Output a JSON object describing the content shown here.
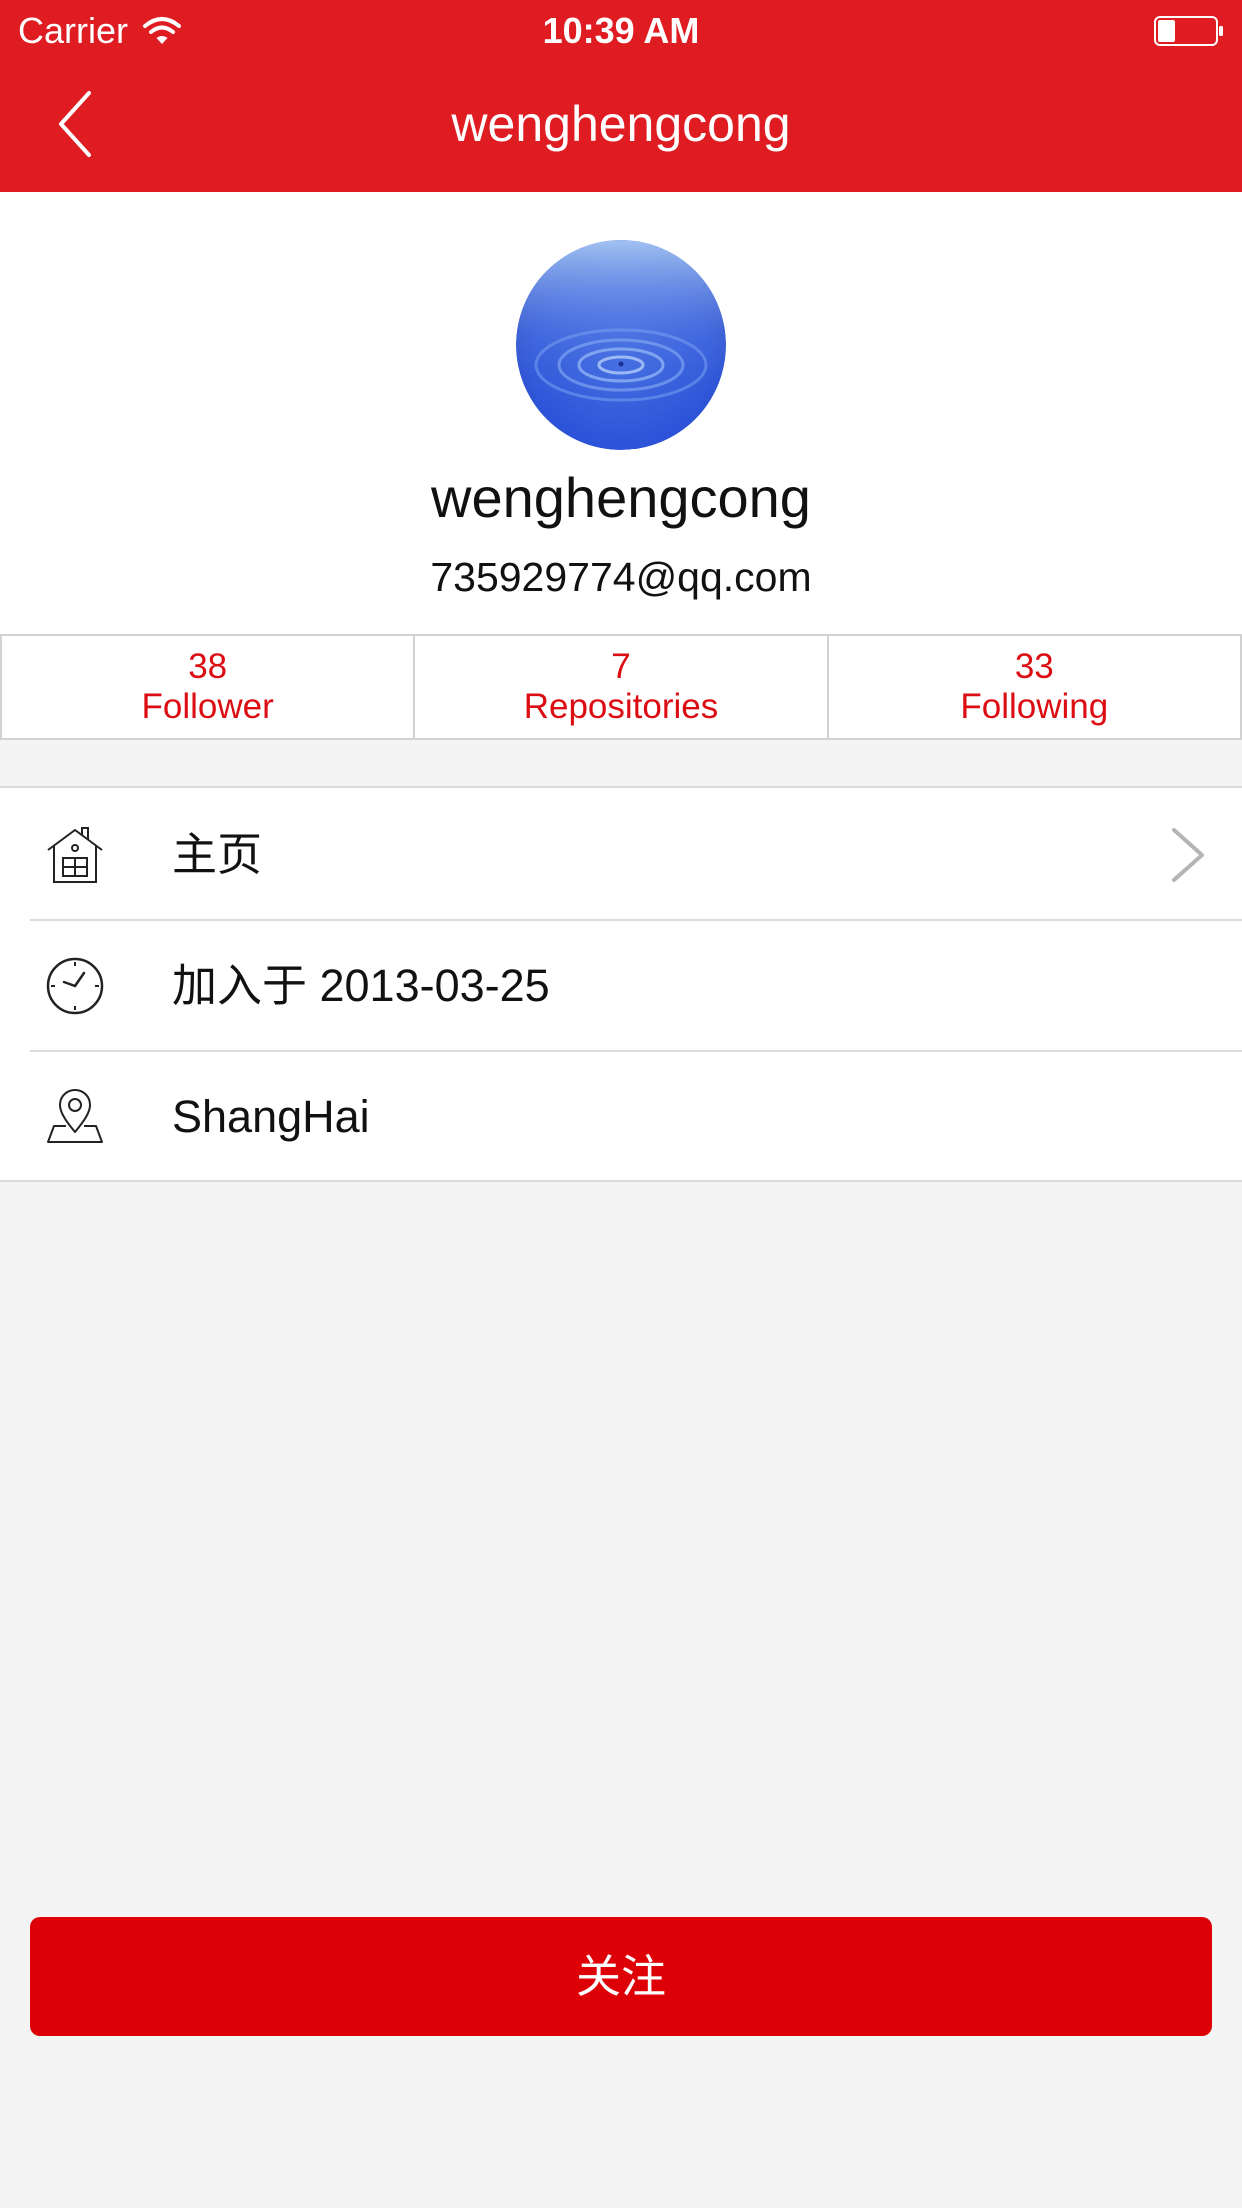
{
  "status_bar": {
    "carrier": "Carrier",
    "time": "10:39 AM",
    "wifi_icon": "wifi-icon",
    "battery_icon": "battery-icon"
  },
  "nav": {
    "title": "wenghengcong",
    "back_icon": "chevron-left-icon",
    "color": "#df1c21"
  },
  "profile": {
    "avatar": "water-ripple-avatar",
    "name": "wenghengcong",
    "email": "735929774@qq.com"
  },
  "stats": [
    {
      "count": "38",
      "label": "Follower"
    },
    {
      "count": "7",
      "label": "Repositories"
    },
    {
      "count": "33",
      "label": "Following"
    }
  ],
  "stats_color": "#dc0d12",
  "info_rows": [
    {
      "icon": "home-icon",
      "label": "主页",
      "chevron": "chevron-right-icon"
    },
    {
      "icon": "clock-icon",
      "label": "加入于 2013-03-25"
    },
    {
      "icon": "location-pin-icon",
      "label": "ShangHai"
    }
  ],
  "follow_button": {
    "label": "关注",
    "color": "#de0007"
  }
}
